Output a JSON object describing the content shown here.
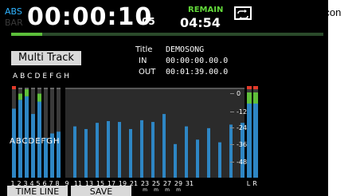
{
  "header": {
    "mode_abs": "ABS",
    "mode_bar": "BAR",
    "time": "00:00:10",
    "frames": "05",
    "remain_label": "REMAIN",
    "remain_time": "04:54",
    "progress": 0.1
  },
  "project": {
    "multi_track_label": "Multi Track",
    "track_letters": "ABCDEFGH",
    "title_label": "Title",
    "title_value": "DEMOSONG",
    "in_label": "IN",
    "in_value": "00:00:00.00.0",
    "out_label": "OUT",
    "out_value": "00:01:39.00.0"
  },
  "meter_scale": [
    "0",
    "-12",
    "-24",
    "-36",
    "-48"
  ],
  "track_stripe": "ABCDEFGH",
  "channel_numbers": [
    "1",
    "2",
    "3",
    "4",
    "5",
    "6",
    "7",
    "8",
    "9",
    "11",
    "13",
    "15",
    "17",
    "19",
    "21",
    "23",
    "25",
    "27",
    "29",
    "31",
    "L",
    "R"
  ],
  "channel_suffix": "m",
  "buttons": {
    "timeline": "TIME LINE",
    "save": "SAVE"
  },
  "callout": {
    "label": "Repeat icon"
  },
  "icons": {
    "repeat": "repeat-icon"
  },
  "colors": {
    "meter_fill": "#2e86c4",
    "meter_green": "#5fbf3a",
    "peak_red": "#e23a2a",
    "remain_green": "#62d83a",
    "abs_blue": "#2fb3ff",
    "meter_background": "#3a3a3a"
  }
}
